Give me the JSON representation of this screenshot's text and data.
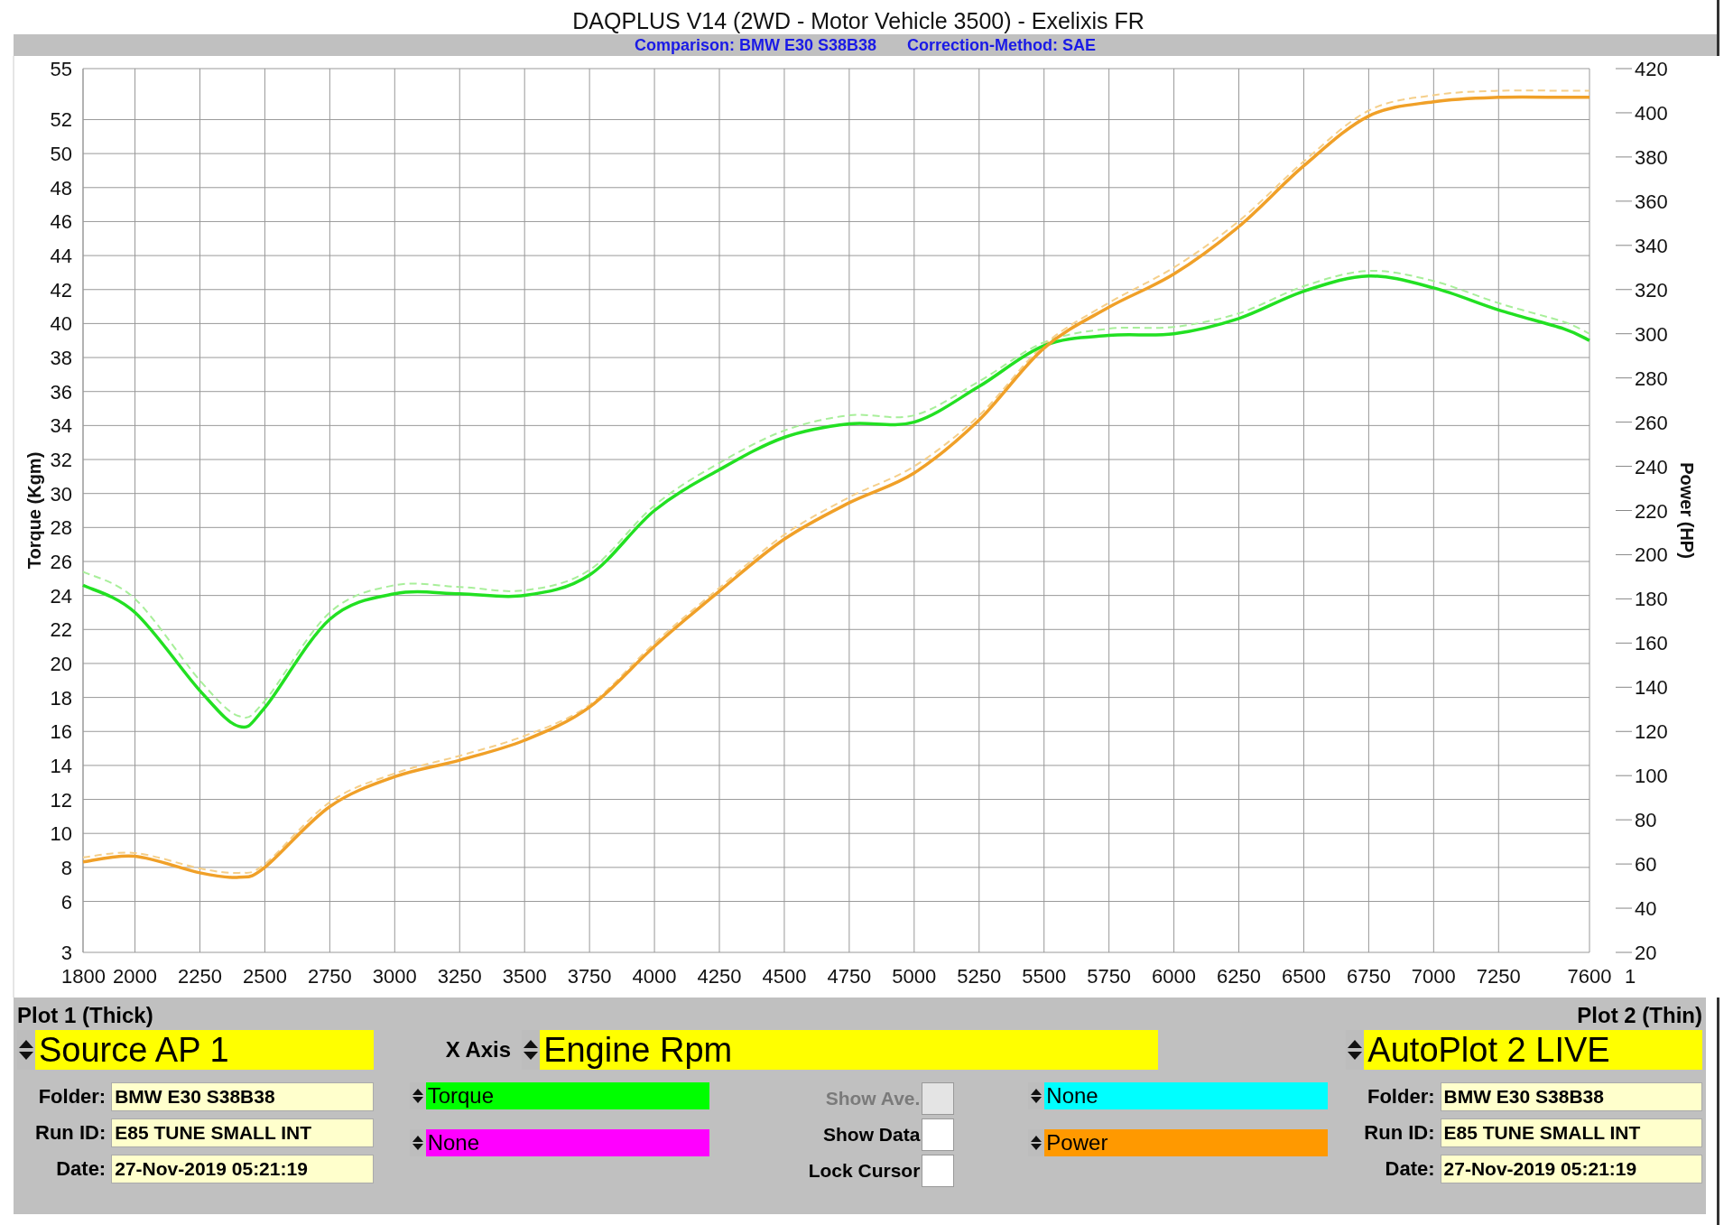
{
  "header": {
    "title": "DAQPLUS V14 (2WD - Motor Vehicle 3500) - Exelixis FR",
    "subtitles": [
      "Comparison: BMW E30 S38B38",
      "Correction-Method: SAE"
    ]
  },
  "chart": {
    "chart_data": {
      "type": "line",
      "ylabel": "Torque (Kgm)",
      "y2label": "Power (HP)",
      "x": [
        1800,
        2000,
        2250,
        2400,
        2500,
        2750,
        3000,
        3250,
        3500,
        3750,
        4000,
        4250,
        4500,
        4750,
        5000,
        5250,
        5500,
        5750,
        6000,
        6250,
        6500,
        6750,
        7000,
        7250,
        7500,
        7600
      ],
      "xlim": [
        1800,
        7600
      ],
      "grid": true,
      "ylim": [
        3,
        55
      ],
      "y2lim": [
        20,
        420
      ],
      "xticks": [
        1800,
        2000,
        2250,
        2500,
        2750,
        3000,
        3250,
        3500,
        3750,
        4000,
        4250,
        4500,
        4750,
        5000,
        5250,
        5500,
        5750,
        6000,
        6250,
        6500,
        6750,
        7000,
        7250,
        7600
      ],
      "yticks": [
        3,
        6,
        8,
        10,
        12,
        14,
        16,
        18,
        20,
        22,
        24,
        26,
        28,
        30,
        32,
        34,
        36,
        38,
        40,
        42,
        44,
        46,
        48,
        50,
        52,
        55
      ],
      "y2ticks": [
        20,
        40,
        60,
        80,
        100,
        120,
        140,
        160,
        180,
        200,
        220,
        240,
        260,
        280,
        300,
        320,
        340,
        360,
        380,
        400,
        420
      ],
      "series": [
        {
          "color": "#a8ef9a",
          "axis": "y",
          "line_style": "dashed",
          "values": [
            25.4,
            23.8,
            19,
            16.9,
            17.8,
            23,
            24.6,
            24.5,
            24.3,
            25.5,
            29.3,
            31.8,
            33.7,
            34.6,
            34.6,
            36.6,
            38.9,
            39.7,
            39.8,
            40.6,
            42.2,
            43.1,
            42.5,
            41.2,
            40.1,
            39.4
          ]
        },
        {
          "color": "#f5cf8a",
          "axis": "y2",
          "line_style": "dashed",
          "values": [
            63,
            65,
            58,
            56,
            60,
            88,
            101,
            109,
            118,
            132,
            160,
            185,
            209,
            226,
            240,
            263,
            295,
            314,
            330,
            351,
            378,
            401,
            408,
            410,
            410,
            410
          ]
        },
        {
          "color": "#22e022",
          "axis": "y",
          "line_style": "solid",
          "values": [
            24.6,
            23,
            18.4,
            16.3,
            17.4,
            22.6,
            24.1,
            24.1,
            24,
            25.2,
            29,
            31.4,
            33.3,
            34.1,
            34.2,
            36.3,
            38.7,
            39.3,
            39.4,
            40.3,
            41.9,
            42.8,
            42.1,
            40.8,
            39.7,
            39.0
          ]
        },
        {
          "color": "#f0a028",
          "axis": "y2",
          "line_style": "solid",
          "values": [
            61,
            63.5,
            56,
            54,
            58.5,
            86,
            99.5,
            107,
            116,
            131,
            158.5,
            183.5,
            207,
            223.5,
            237,
            261,
            293.5,
            312,
            327,
            348.5,
            376,
            398.5,
            405,
            407,
            407,
            407
          ]
        }
      ]
    },
    "corner_label": "1"
  },
  "plot1": {
    "title": "Plot 1 (Thick)",
    "source": "Source AP 1",
    "fields": [
      {
        "label": "Folder:",
        "value": "BMW E30 S38B38"
      },
      {
        "label": "Run ID:",
        "value": "E85 TUNE SMALL INT"
      },
      {
        "label": "Date:",
        "value": "27-Nov-2019 05:21:19"
      }
    ]
  },
  "x_axis": {
    "label": "X Axis",
    "value": "Engine Rpm"
  },
  "channels_left": [
    {
      "value": "Torque",
      "color": "#00ff00"
    },
    {
      "value": "None",
      "color": "#ff00ff"
    }
  ],
  "options": [
    {
      "label": "Show Ave.",
      "checked": false,
      "disabled": true
    },
    {
      "label": "Show Data",
      "checked": false,
      "disabled": false
    },
    {
      "label": "Lock Cursor",
      "checked": false,
      "disabled": false
    }
  ],
  "channels_right": [
    {
      "value": "None",
      "color": "#00ffff"
    },
    {
      "value": "Power",
      "color": "#ff9900"
    }
  ],
  "plot2": {
    "title": "Plot 2 (Thin)",
    "source": "AutoPlot 2 LIVE",
    "fields": [
      {
        "label": "Folder:",
        "value": "BMW E30 S38B38"
      },
      {
        "label": "Run ID:",
        "value": "E85 TUNE SMALL INT"
      },
      {
        "label": "Date:",
        "value": "27-Nov-2019 05:21:19"
      }
    ]
  }
}
